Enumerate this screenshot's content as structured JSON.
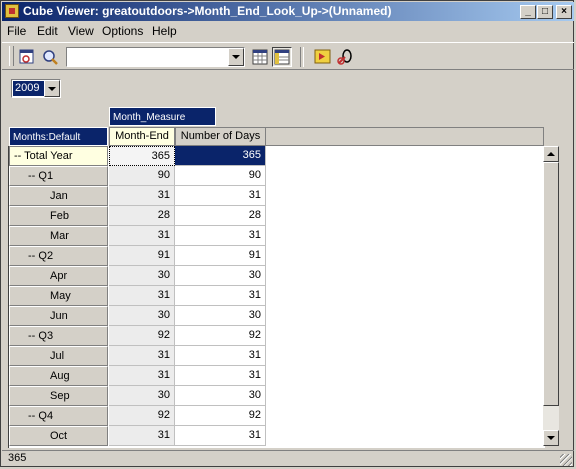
{
  "window": {
    "title": "Cube Viewer: greatoutdoors->Month_End_Look_Up->(Unnamed)",
    "controls": {
      "minimize": "_",
      "maximize": "□",
      "close": "×"
    }
  },
  "menu": {
    "file": "File",
    "edit": "Edit",
    "view": "View",
    "options": "Options",
    "help": "Help"
  },
  "toolbar": {
    "view_combo_value": "",
    "icons": [
      "recalculate-icon",
      "zoom-icon",
      "grid-view-icon",
      "tabular-view-icon",
      "execute-icon",
      "zero-suppress-icon"
    ]
  },
  "title_dimension": {
    "year": "2009"
  },
  "grid": {
    "column_dimension": "Month_Measure",
    "row_dimension": "Months:Default",
    "columns": [
      "Month-End",
      "Number of Days"
    ],
    "rows": [
      {
        "label": "-- Total Year",
        "indent": 0,
        "values": [
          "365",
          "365"
        ]
      },
      {
        "label": "-- Q1",
        "indent": 1,
        "values": [
          "90",
          "90"
        ]
      },
      {
        "label": "Jan",
        "indent": 2,
        "values": [
          "31",
          "31"
        ]
      },
      {
        "label": "Feb",
        "indent": 2,
        "values": [
          "28",
          "28"
        ]
      },
      {
        "label": "Mar",
        "indent": 2,
        "values": [
          "31",
          "31"
        ]
      },
      {
        "label": "-- Q2",
        "indent": 1,
        "values": [
          "91",
          "91"
        ]
      },
      {
        "label": "Apr",
        "indent": 2,
        "values": [
          "30",
          "30"
        ]
      },
      {
        "label": "May",
        "indent": 2,
        "values": [
          "31",
          "31"
        ]
      },
      {
        "label": "Jun",
        "indent": 2,
        "values": [
          "30",
          "30"
        ]
      },
      {
        "label": "-- Q3",
        "indent": 1,
        "values": [
          "92",
          "92"
        ]
      },
      {
        "label": "Jul",
        "indent": 2,
        "values": [
          "31",
          "31"
        ]
      },
      {
        "label": "Aug",
        "indent": 2,
        "values": [
          "31",
          "31"
        ]
      },
      {
        "label": "Sep",
        "indent": 2,
        "values": [
          "30",
          "30"
        ]
      },
      {
        "label": "-- Q4",
        "indent": 1,
        "values": [
          "92",
          "92"
        ]
      },
      {
        "label": "Oct",
        "indent": 2,
        "values": [
          "31",
          "31"
        ]
      }
    ]
  },
  "status": {
    "text": "365"
  },
  "colors": {
    "selection": "#0a246a",
    "header_highlight": "#ffffe1",
    "face": "#d4d0c8"
  }
}
